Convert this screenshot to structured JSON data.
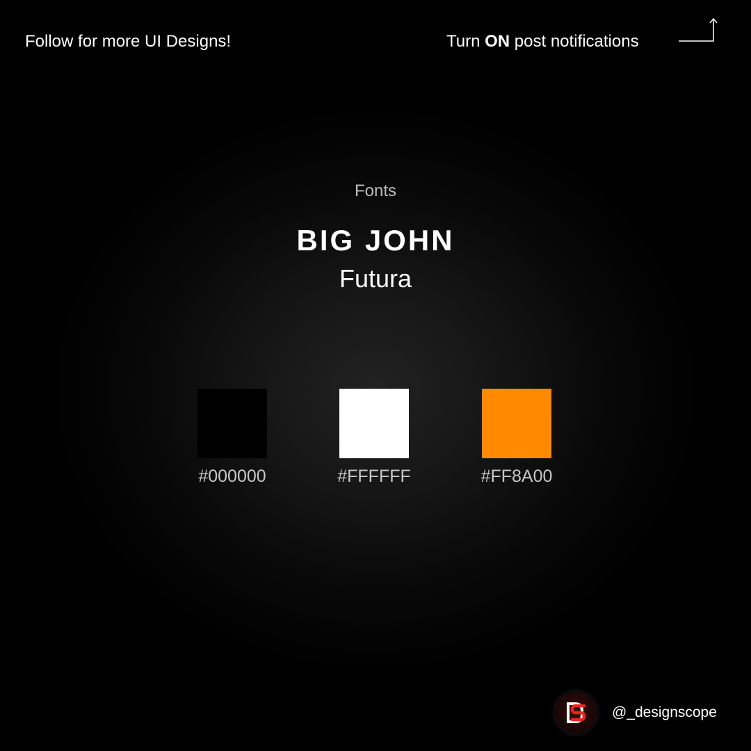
{
  "header": {
    "follow_text": "Follow for more UI Designs!",
    "notif_prefix": "Turn ",
    "notif_bold": "ON",
    "notif_suffix": " post notifications"
  },
  "fonts": {
    "section_title": "Fonts",
    "primary": "BIG JOHN",
    "secondary": "Futura"
  },
  "palette": [
    {
      "hex": "#000000",
      "label": "#000000"
    },
    {
      "hex": "#FFFFFF",
      "label": "#FFFFFF"
    },
    {
      "hex": "#FF8A00",
      "label": "#FF8A00"
    }
  ],
  "brand": {
    "handle": "@_designscope",
    "logo_icon": "designscope-logo-icon",
    "logo_accent": "#e8261f"
  }
}
